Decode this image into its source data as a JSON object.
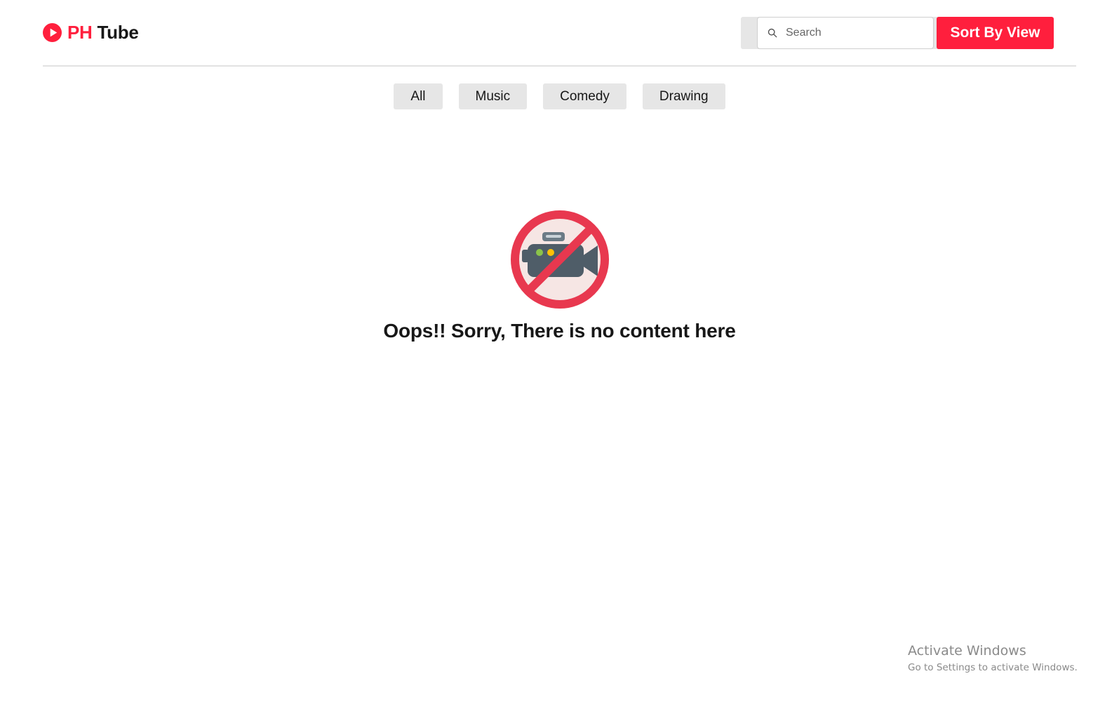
{
  "header": {
    "brand_prefix": "PH",
    "brand_name": "Tube",
    "search": {
      "placeholder": "Search",
      "value": ""
    },
    "sort_label": "Sort By View"
  },
  "categories": [
    {
      "label": "All"
    },
    {
      "label": "Music"
    },
    {
      "label": "Comedy"
    },
    {
      "label": "Drawing"
    }
  ],
  "empty_state": {
    "message": "Oops!! Sorry, There is no content here",
    "icon": "no-video-icon"
  },
  "watermark": {
    "title": "Activate Windows",
    "subtitle": "Go to Settings to activate Windows."
  },
  "colors": {
    "accent": "#ff1f3d",
    "tab_background": "#e6e6e6",
    "text": "#171717"
  }
}
